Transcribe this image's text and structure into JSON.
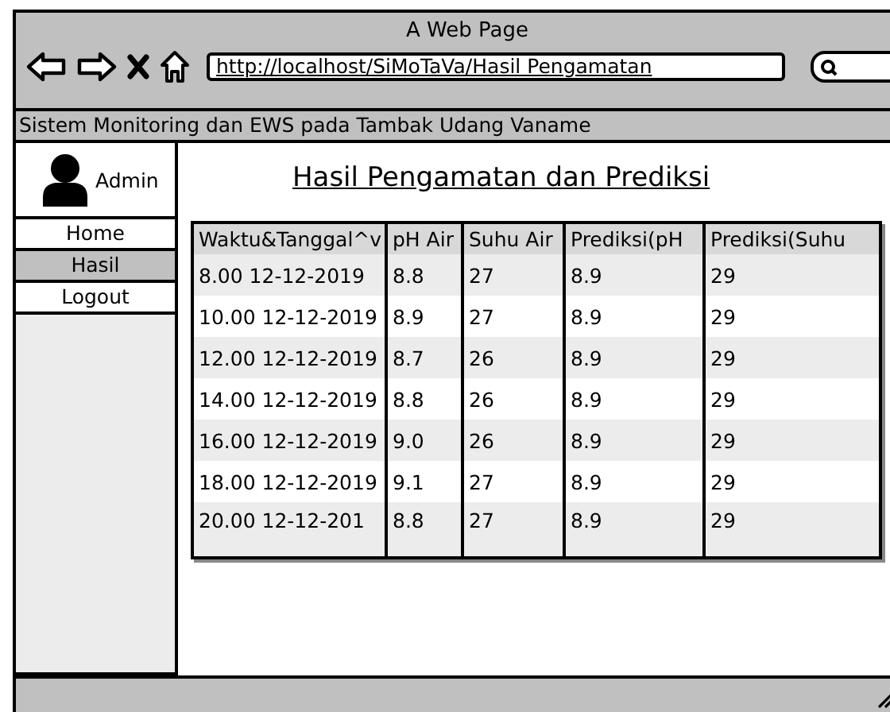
{
  "window": {
    "title": "A Web Page"
  },
  "browser": {
    "url": "http://localhost/SiMoTaVa/Hasil Pengamatan"
  },
  "banner": "Sistem Monitoring dan EWS pada Tambak Udang Vaname",
  "sidebar": {
    "user": "Admin",
    "items": [
      {
        "label": "Home",
        "selected": false
      },
      {
        "label": "Hasil",
        "selected": true
      },
      {
        "label": "Logout",
        "selected": false
      }
    ]
  },
  "heading": "Hasil Pengamatan dan Prediksi",
  "table": {
    "columns": [
      "Waktu&Tanggal^v",
      "pH Air",
      "Suhu Air",
      "Prediksi(pH",
      "Prediksi(Suhu"
    ],
    "rows": [
      [
        "8.00 12-12-2019",
        "8.8",
        "27",
        "8.9",
        "29"
      ],
      [
        "10.00 12-12-2019",
        "8.9",
        "27",
        "8.9",
        "29"
      ],
      [
        "12.00 12-12-2019",
        "8.7",
        "26",
        "8.9",
        "29"
      ],
      [
        "14.00 12-12-2019",
        "8.8",
        "26",
        "8.9",
        "29"
      ],
      [
        "16.00 12-12-2019",
        "9.0",
        "26",
        "8.9",
        "29"
      ],
      [
        "18.00 12-12-2019",
        "9.1",
        "27",
        "8.9",
        "29"
      ],
      [
        "20.00 12-12-201",
        "8.8",
        "27",
        "8.9",
        "29"
      ]
    ]
  }
}
